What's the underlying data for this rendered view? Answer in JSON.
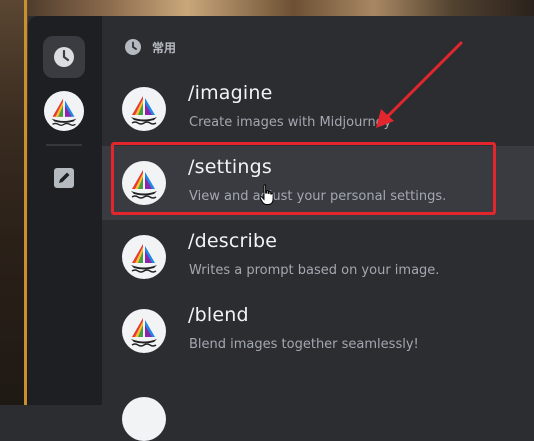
{
  "section": {
    "label": "常用",
    "icon": "clock-icon"
  },
  "rail": [
    {
      "name": "recent",
      "icon": "clock-icon"
    },
    {
      "name": "midjourney-bot",
      "icon": "sailboat-icon"
    },
    {
      "name": "app",
      "icon": "pencil-icon"
    }
  ],
  "commands": [
    {
      "name": "/imagine",
      "description": "Create images with Midjourney",
      "selected": false
    },
    {
      "name": "/settings",
      "description": "View and adjust your personal settings.",
      "selected": true
    },
    {
      "name": "/describe",
      "description": "Writes a prompt based on your image.",
      "selected": false
    },
    {
      "name": "/blend",
      "description": "Blend images together seamlessly!",
      "selected": false
    }
  ],
  "annotation": {
    "color": "#e3262e"
  },
  "colors": {
    "panel": "#2b2d31",
    "rail": "#1e1f22",
    "selected_row": "#393b41",
    "text": "#f2f3f5",
    "muted": "#a3a8b0"
  }
}
